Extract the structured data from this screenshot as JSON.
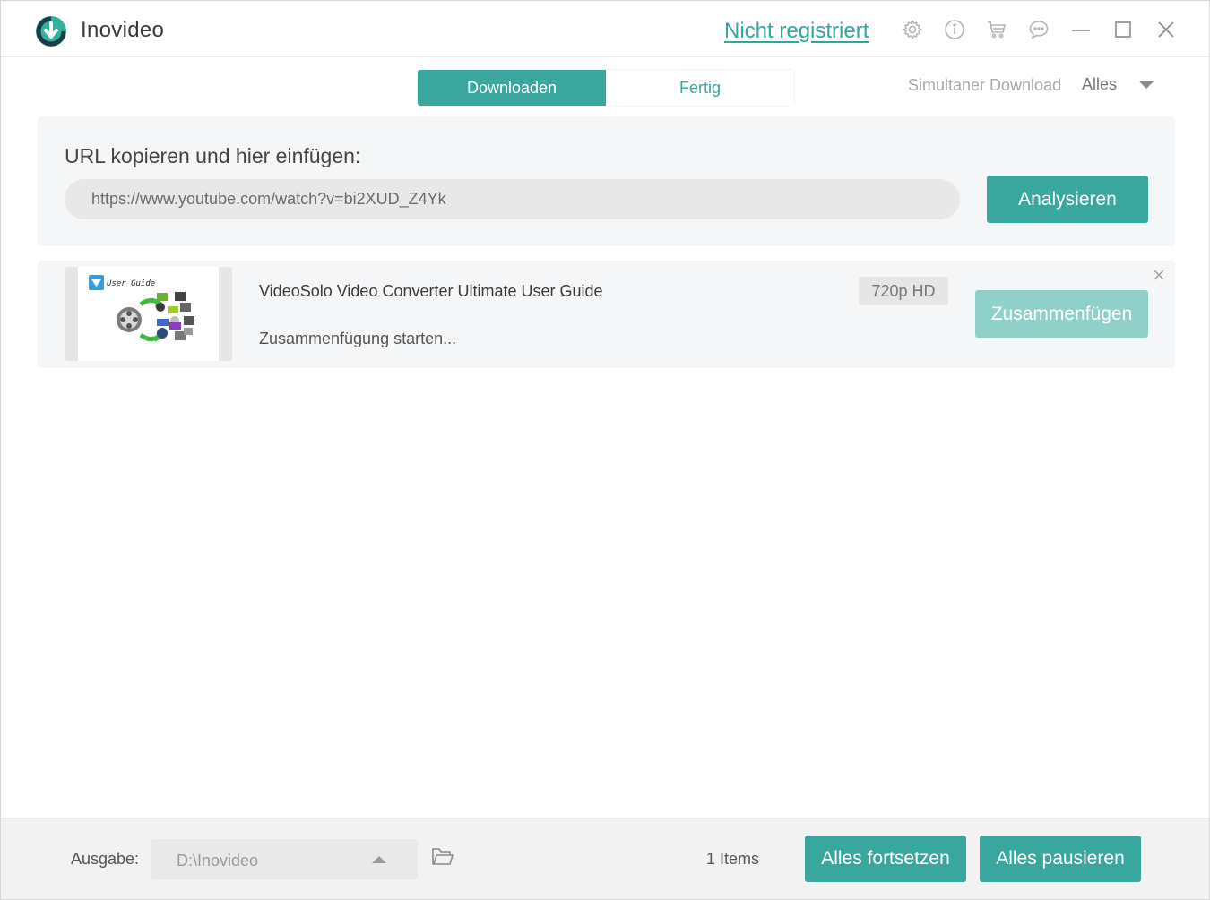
{
  "app": {
    "title": "Inovideo",
    "register_link": "Nicht registriert"
  },
  "titlebar_icons": [
    "gear-icon",
    "info-icon",
    "cart-icon",
    "chat-icon",
    "minimize-icon",
    "maximize-icon",
    "close-icon"
  ],
  "tabs": [
    {
      "label": "Downloaden",
      "active": true
    },
    {
      "label": "Fertig",
      "active": false
    }
  ],
  "simultaneous": {
    "label": "Simultaner Download",
    "value": "Alles"
  },
  "url_panel": {
    "heading": "URL kopieren und hier einfügen:",
    "url_value": "https://www.youtube.com/watch?v=bi2XUD_Z4Yk",
    "analyze_label": "Analysieren"
  },
  "items": [
    {
      "thumbnail_text": "User Guide",
      "title": "VideoSolo Video Converter Ultimate User Guide",
      "status": "Zusammenfügung starten...",
      "quality": "720p HD",
      "merge_label": "Zusammenfügen"
    }
  ],
  "footer": {
    "output_label": "Ausgabe:",
    "output_path": "D:\\Inovideo",
    "item_count": "1 Items",
    "resume_all_label": "Alles fortsetzen",
    "pause_all_label": "Alles pausieren"
  },
  "colors": {
    "accent": "#3aa79f",
    "accent_disabled": "#8fd0c9",
    "link": "#2ea79c",
    "panel_bg": "#f5f6f7",
    "footer_bg": "#f2f2f2"
  }
}
